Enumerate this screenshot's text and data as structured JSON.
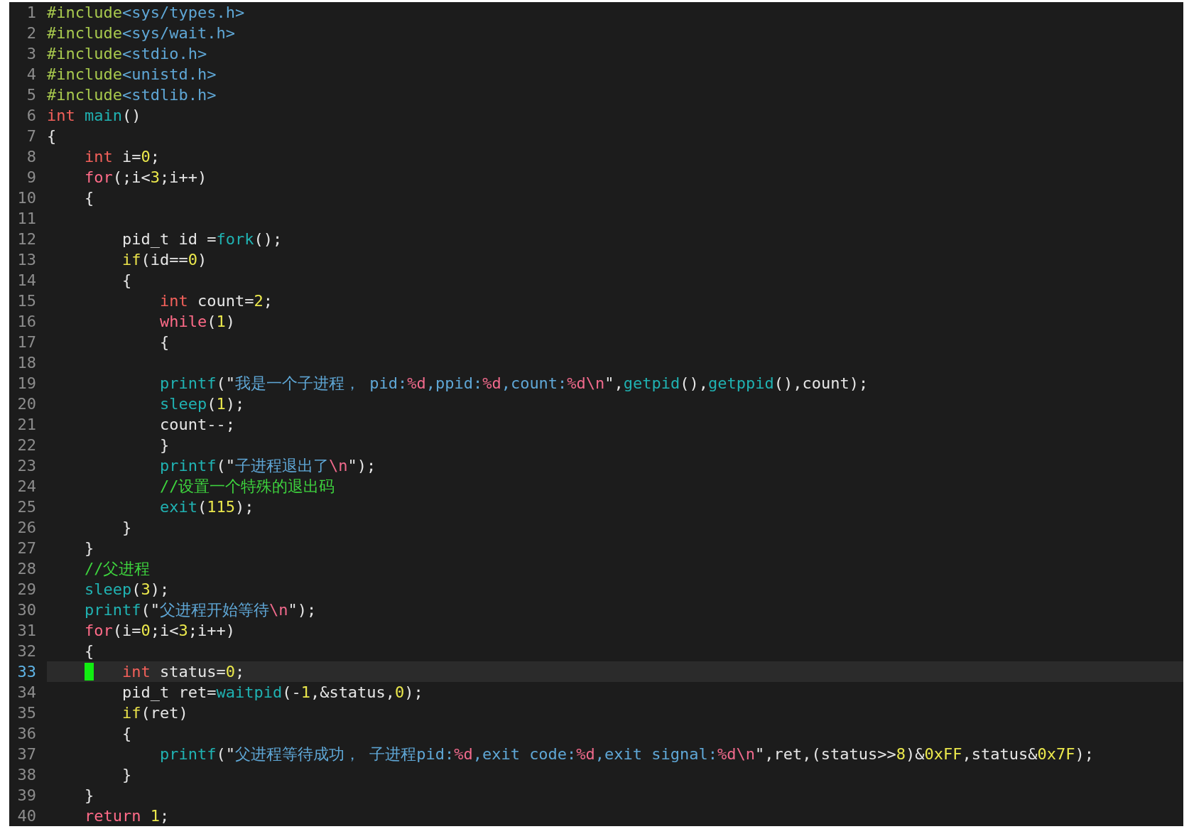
{
  "editor": {
    "lines": [
      {
        "number": "1",
        "current": false,
        "tokens": [
          {
            "kind": "pre",
            "text": "#include"
          },
          {
            "kind": "hdr",
            "text": "<sys/types.h>"
          }
        ]
      },
      {
        "number": "2",
        "current": false,
        "tokens": [
          {
            "kind": "pre",
            "text": "#include"
          },
          {
            "kind": "hdr",
            "text": "<sys/wait.h>"
          }
        ]
      },
      {
        "number": "3",
        "current": false,
        "tokens": [
          {
            "kind": "pre",
            "text": "#include"
          },
          {
            "kind": "hdr",
            "text": "<stdio.h>"
          }
        ]
      },
      {
        "number": "4",
        "current": false,
        "tokens": [
          {
            "kind": "pre",
            "text": "#include"
          },
          {
            "kind": "hdr",
            "text": "<unistd.h>"
          }
        ]
      },
      {
        "number": "5",
        "current": false,
        "tokens": [
          {
            "kind": "pre",
            "text": "#include"
          },
          {
            "kind": "hdr",
            "text": "<stdlib.h>"
          }
        ]
      },
      {
        "number": "6",
        "current": false,
        "tokens": [
          {
            "kind": "type",
            "text": "int"
          },
          {
            "kind": "func",
            "text": " main"
          },
          {
            "kind": "plain",
            "text": "()"
          }
        ]
      },
      {
        "number": "7",
        "current": false,
        "tokens": [
          {
            "kind": "plain",
            "text": "{"
          }
        ]
      },
      {
        "number": "8",
        "current": false,
        "tokens": [
          {
            "kind": "type",
            "text": "    int"
          },
          {
            "kind": "plain",
            "text": " i="
          },
          {
            "kind": "num",
            "text": "0"
          },
          {
            "kind": "plain",
            "text": ";"
          }
        ]
      },
      {
        "number": "9",
        "current": false,
        "tokens": [
          {
            "kind": "kw",
            "text": "    for"
          },
          {
            "kind": "plain",
            "text": "(;i<"
          },
          {
            "kind": "num",
            "text": "3"
          },
          {
            "kind": "plain",
            "text": ";i++)"
          }
        ]
      },
      {
        "number": "10",
        "current": false,
        "tokens": [
          {
            "kind": "plain",
            "text": "    {"
          }
        ]
      },
      {
        "number": "11",
        "current": false
      },
      {
        "number": "12",
        "current": false,
        "tokens": [
          {
            "kind": "plain",
            "text": "        pid_t id ="
          },
          {
            "kind": "func",
            "text": "fork"
          },
          {
            "kind": "plain",
            "text": "();"
          }
        ]
      },
      {
        "number": "13",
        "current": false,
        "tokens": [
          {
            "kind": "cond",
            "text": "        if"
          },
          {
            "kind": "plain",
            "text": "(id=="
          },
          {
            "kind": "num",
            "text": "0"
          },
          {
            "kind": "plain",
            "text": ")"
          }
        ]
      },
      {
        "number": "14",
        "current": false,
        "tokens": [
          {
            "kind": "plain",
            "text": "        {"
          }
        ]
      },
      {
        "number": "15",
        "current": false,
        "tokens": [
          {
            "kind": "type",
            "text": "            int"
          },
          {
            "kind": "plain",
            "text": " count="
          },
          {
            "kind": "num",
            "text": "2"
          },
          {
            "kind": "plain",
            "text": ";"
          }
        ]
      },
      {
        "number": "16",
        "current": false,
        "tokens": [
          {
            "kind": "kw",
            "text": "            while"
          },
          {
            "kind": "plain",
            "text": "("
          },
          {
            "kind": "num",
            "text": "1"
          },
          {
            "kind": "plain",
            "text": ")"
          }
        ]
      },
      {
        "number": "17",
        "current": false,
        "tokens": [
          {
            "kind": "plain",
            "text": "            {"
          }
        ]
      },
      {
        "number": "18",
        "current": false
      },
      {
        "number": "19",
        "current": false,
        "tokens": [
          {
            "kind": "func",
            "text": "            printf"
          },
          {
            "kind": "plain",
            "text": "(\""
          },
          {
            "kind": "str",
            "text": "我是一个子进程， pid:"
          },
          {
            "kind": "fmt",
            "text": "%d"
          },
          {
            "kind": "str",
            "text": ",ppid:"
          },
          {
            "kind": "fmt",
            "text": "%d"
          },
          {
            "kind": "str",
            "text": ",count:"
          },
          {
            "kind": "fmt",
            "text": "%d\\n"
          },
          {
            "kind": "plain",
            "text": "\","
          },
          {
            "kind": "func",
            "text": "getpid"
          },
          {
            "kind": "plain",
            "text": "(),"
          },
          {
            "kind": "func",
            "text": "getppid"
          },
          {
            "kind": "plain",
            "text": "(),count);"
          }
        ]
      },
      {
        "number": "20",
        "current": false,
        "tokens": [
          {
            "kind": "func",
            "text": "            sleep"
          },
          {
            "kind": "plain",
            "text": "("
          },
          {
            "kind": "num",
            "text": "1"
          },
          {
            "kind": "plain",
            "text": ");"
          }
        ]
      },
      {
        "number": "21",
        "current": false,
        "tokens": [
          {
            "kind": "plain",
            "text": "            count--;"
          }
        ]
      },
      {
        "number": "22",
        "current": false,
        "tokens": [
          {
            "kind": "plain",
            "text": "            }"
          }
        ]
      },
      {
        "number": "23",
        "current": false,
        "tokens": [
          {
            "kind": "func",
            "text": "            printf"
          },
          {
            "kind": "plain",
            "text": "(\""
          },
          {
            "kind": "str",
            "text": "子进程退出了"
          },
          {
            "kind": "fmt",
            "text": "\\n"
          },
          {
            "kind": "plain",
            "text": "\");"
          }
        ]
      },
      {
        "number": "24",
        "current": false,
        "tokens": [
          {
            "kind": "comment",
            "text": "            //设置一个特殊的退出码"
          }
        ]
      },
      {
        "number": "25",
        "current": false,
        "tokens": [
          {
            "kind": "func",
            "text": "            exit"
          },
          {
            "kind": "plain",
            "text": "("
          },
          {
            "kind": "num",
            "text": "115"
          },
          {
            "kind": "plain",
            "text": ");"
          }
        ]
      },
      {
        "number": "26",
        "current": false,
        "tokens": [
          {
            "kind": "plain",
            "text": "        }"
          }
        ]
      },
      {
        "number": "27",
        "current": false,
        "tokens": [
          {
            "kind": "plain",
            "text": "    }"
          }
        ]
      },
      {
        "number": "28",
        "current": false,
        "tokens": [
          {
            "kind": "comment",
            "text": "    //父进程"
          }
        ]
      },
      {
        "number": "29",
        "current": false,
        "tokens": [
          {
            "kind": "func",
            "text": "    sleep"
          },
          {
            "kind": "plain",
            "text": "("
          },
          {
            "kind": "num",
            "text": "3"
          },
          {
            "kind": "plain",
            "text": ");"
          }
        ]
      },
      {
        "number": "30",
        "current": false,
        "tokens": [
          {
            "kind": "func",
            "text": "    printf"
          },
          {
            "kind": "plain",
            "text": "(\""
          },
          {
            "kind": "str",
            "text": "父进程开始等待"
          },
          {
            "kind": "fmt",
            "text": "\\n"
          },
          {
            "kind": "plain",
            "text": "\");"
          }
        ]
      },
      {
        "number": "31",
        "current": false,
        "tokens": [
          {
            "kind": "kw",
            "text": "    for"
          },
          {
            "kind": "plain",
            "text": "(i="
          },
          {
            "kind": "num",
            "text": "0"
          },
          {
            "kind": "plain",
            "text": ";i<"
          },
          {
            "kind": "num",
            "text": "3"
          },
          {
            "kind": "plain",
            "text": ";i++)"
          }
        ]
      },
      {
        "number": "32",
        "current": false,
        "tokens": [
          {
            "kind": "plain",
            "text": "    {"
          }
        ]
      },
      {
        "number": "33",
        "current": true,
        "cursor": true,
        "tokens": [
          {
            "kind": "type",
            "text": "        int"
          },
          {
            "kind": "plain",
            "text": " status="
          },
          {
            "kind": "num",
            "text": "0"
          },
          {
            "kind": "plain",
            "text": ";"
          }
        ]
      },
      {
        "number": "34",
        "current": false,
        "tokens": [
          {
            "kind": "plain",
            "text": "        pid_t ret="
          },
          {
            "kind": "func",
            "text": "waitpid"
          },
          {
            "kind": "plain",
            "text": "(-"
          },
          {
            "kind": "num",
            "text": "1"
          },
          {
            "kind": "plain",
            "text": ",&status,"
          },
          {
            "kind": "num",
            "text": "0"
          },
          {
            "kind": "plain",
            "text": ");"
          }
        ]
      },
      {
        "number": "35",
        "current": false,
        "tokens": [
          {
            "kind": "cond",
            "text": "        if"
          },
          {
            "kind": "plain",
            "text": "(ret)"
          }
        ]
      },
      {
        "number": "36",
        "current": false,
        "tokens": [
          {
            "kind": "plain",
            "text": "        {"
          }
        ]
      },
      {
        "number": "37",
        "current": false,
        "tokens": [
          {
            "kind": "func",
            "text": "            printf"
          },
          {
            "kind": "plain",
            "text": "(\""
          },
          {
            "kind": "str",
            "text": "父进程等待成功， 子进程pid:"
          },
          {
            "kind": "fmt",
            "text": "%d"
          },
          {
            "kind": "str",
            "text": ",exit code:"
          },
          {
            "kind": "fmt",
            "text": "%d"
          },
          {
            "kind": "str",
            "text": ",exit signal:"
          },
          {
            "kind": "fmt",
            "text": "%d\\n"
          },
          {
            "kind": "plain",
            "text": "\",ret,(status>>"
          },
          {
            "kind": "num",
            "text": "8"
          },
          {
            "kind": "plain",
            "text": ")&"
          },
          {
            "kind": "num",
            "text": "0xFF"
          },
          {
            "kind": "plain",
            "text": ",status&"
          },
          {
            "kind": "num",
            "text": "0x7F"
          },
          {
            "kind": "plain",
            "text": ");"
          }
        ]
      },
      {
        "number": "38",
        "current": false,
        "tokens": [
          {
            "kind": "plain",
            "text": "        }"
          }
        ]
      },
      {
        "number": "39",
        "current": false,
        "tokens": [
          {
            "kind": "plain",
            "text": "    }"
          }
        ]
      },
      {
        "number": "40",
        "current": false,
        "tokens": [
          {
            "kind": "kw",
            "text": "    return"
          },
          {
            "kind": "num",
            "text": " 1"
          },
          {
            "kind": "plain",
            "text": ";"
          }
        ]
      }
    ]
  }
}
